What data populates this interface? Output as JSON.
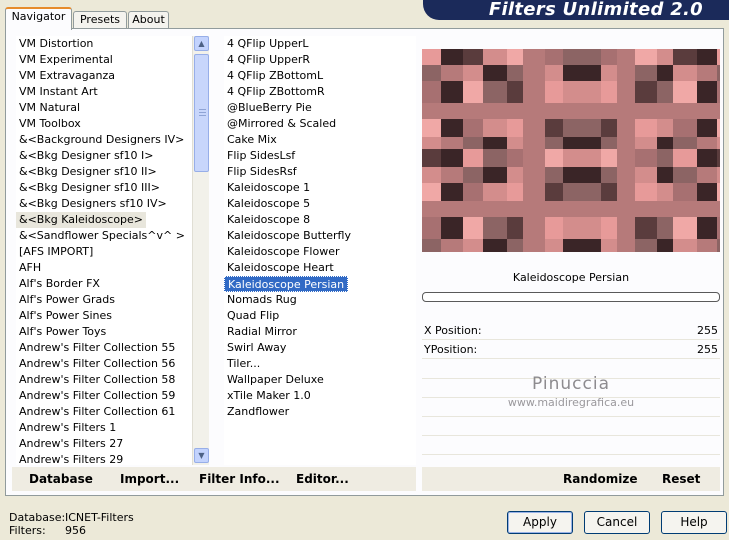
{
  "banner": {
    "title": "Filters Unlimited 2.0"
  },
  "tabs": [
    {
      "label": "Navigator",
      "active": true
    },
    {
      "label": "Presets",
      "active": false
    },
    {
      "label": "About",
      "active": false
    }
  ],
  "categories": [
    "VM Distortion",
    "VM Experimental",
    "VM Extravaganza",
    "VM Instant Art",
    "VM Natural",
    "VM Toolbox",
    "&<Background Designers IV>",
    "&<Bkg Designer sf10 I>",
    "&<Bkg Designer sf10 II>",
    "&<Bkg Designer sf10 III>",
    "&<Bkg Designers sf10 IV>",
    "&<Bkg Kaleidoscope>",
    "&<Sandflower Specials^v^ >",
    "[AFS IMPORT]",
    "AFH",
    "Alf's Border FX",
    "Alf's Power Grads",
    "Alf's Power Sines",
    "Alf's Power Toys",
    "Andrew's Filter Collection 55",
    "Andrew's Filter Collection 56",
    "Andrew's Filter Collection 58",
    "Andrew's Filter Collection 59",
    "Andrew's Filter Collection 61",
    "Andrew's Filters 1",
    "Andrew's Filters 27",
    "Andrew's Filters 29"
  ],
  "selected_category": "&<Bkg Kaleidoscope>",
  "filters": [
    "4 QFlip UpperL",
    "4 QFlip UpperR",
    "4 QFlip ZBottomL",
    "4 QFlip ZBottomR",
    "@BlueBerry Pie",
    "@Mirrored & Scaled",
    "Cake Mix",
    "Flip SidesLsf",
    "Flip SidesRsf",
    "Kaleidoscope 1",
    "Kaleidoscope 5",
    "Kaleidoscope 8",
    "Kaleidoscope Butterfly",
    "Kaleidoscope Flower",
    "Kaleidoscope Heart",
    "Kaleidoscope Persian",
    "Nomads Rug",
    "Quad Flip",
    "Radial Mirror",
    "Swirl Away",
    "Tiler...",
    "Wallpaper Deluxe",
    "xTile Maker 1.0",
    "Zandflower"
  ],
  "selected_filter": "Kaleidoscope Persian",
  "preview": {
    "filter_name": "Kaleidoscope Persian"
  },
  "params": [
    {
      "label": "X Position:",
      "value": "255"
    },
    {
      "label": "YPosition:",
      "value": "255"
    }
  ],
  "watermark": {
    "name": "Pinuccia",
    "site": "www.maidiregrafica.eu"
  },
  "commands_left": [
    "Database",
    "Import...",
    "Filter Info...",
    "Editor..."
  ],
  "commands_right": [
    "Randomize",
    "Reset"
  ],
  "status": {
    "database_label": "Database:",
    "database_value": "ICNET-Filters",
    "filters_label": "Filters:",
    "filters_value": "956"
  },
  "buttons": {
    "apply": "Apply",
    "cancel": "Cancel",
    "help": "Help"
  },
  "colors": {
    "selection": "#316ac5",
    "banner": "#1b2a5a",
    "tab_accent": "#e68b2c"
  }
}
